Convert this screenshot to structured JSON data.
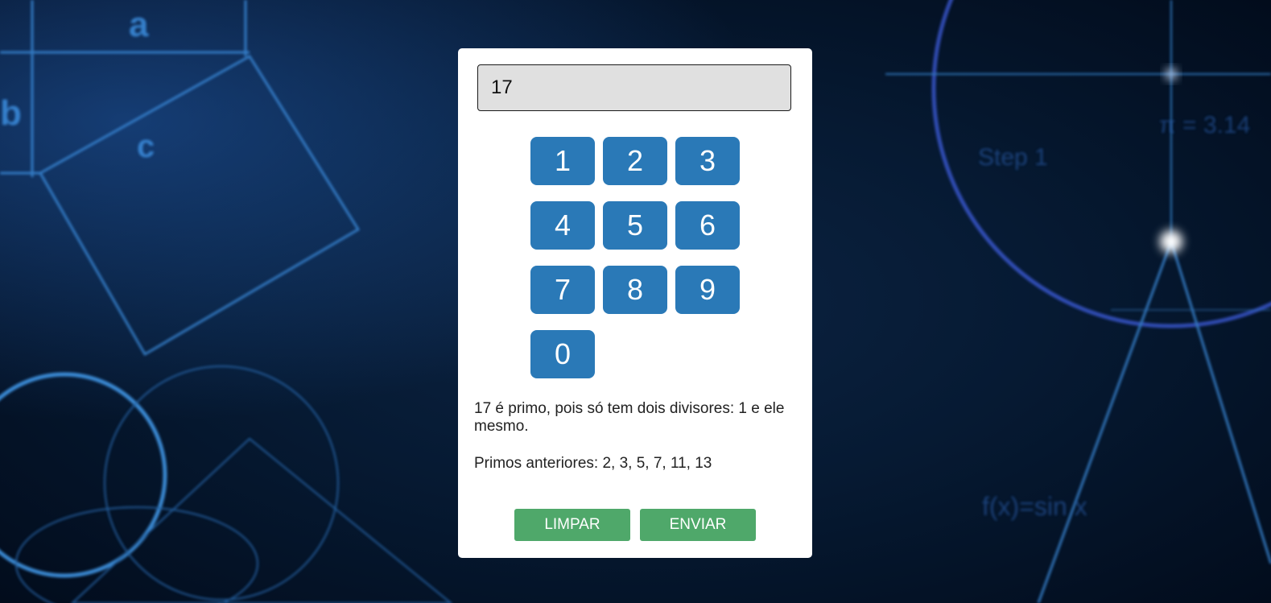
{
  "display": {
    "value": "17"
  },
  "keypad": {
    "keys": [
      "1",
      "2",
      "3",
      "4",
      "5",
      "6",
      "7",
      "8",
      "9",
      "0"
    ]
  },
  "result": {
    "message": "17 é primo, pois só tem dois divisores: 1 e ele mesmo.",
    "previous_primes": "Primos anteriores: 2, 3, 5, 7, 11, 13"
  },
  "buttons": {
    "clear_label": "LIMPAR",
    "submit_label": "ENVIAR"
  },
  "colors": {
    "key_blue": "#2a79b7",
    "action_green": "#4fa86a",
    "display_bg": "#e0e0e0"
  }
}
